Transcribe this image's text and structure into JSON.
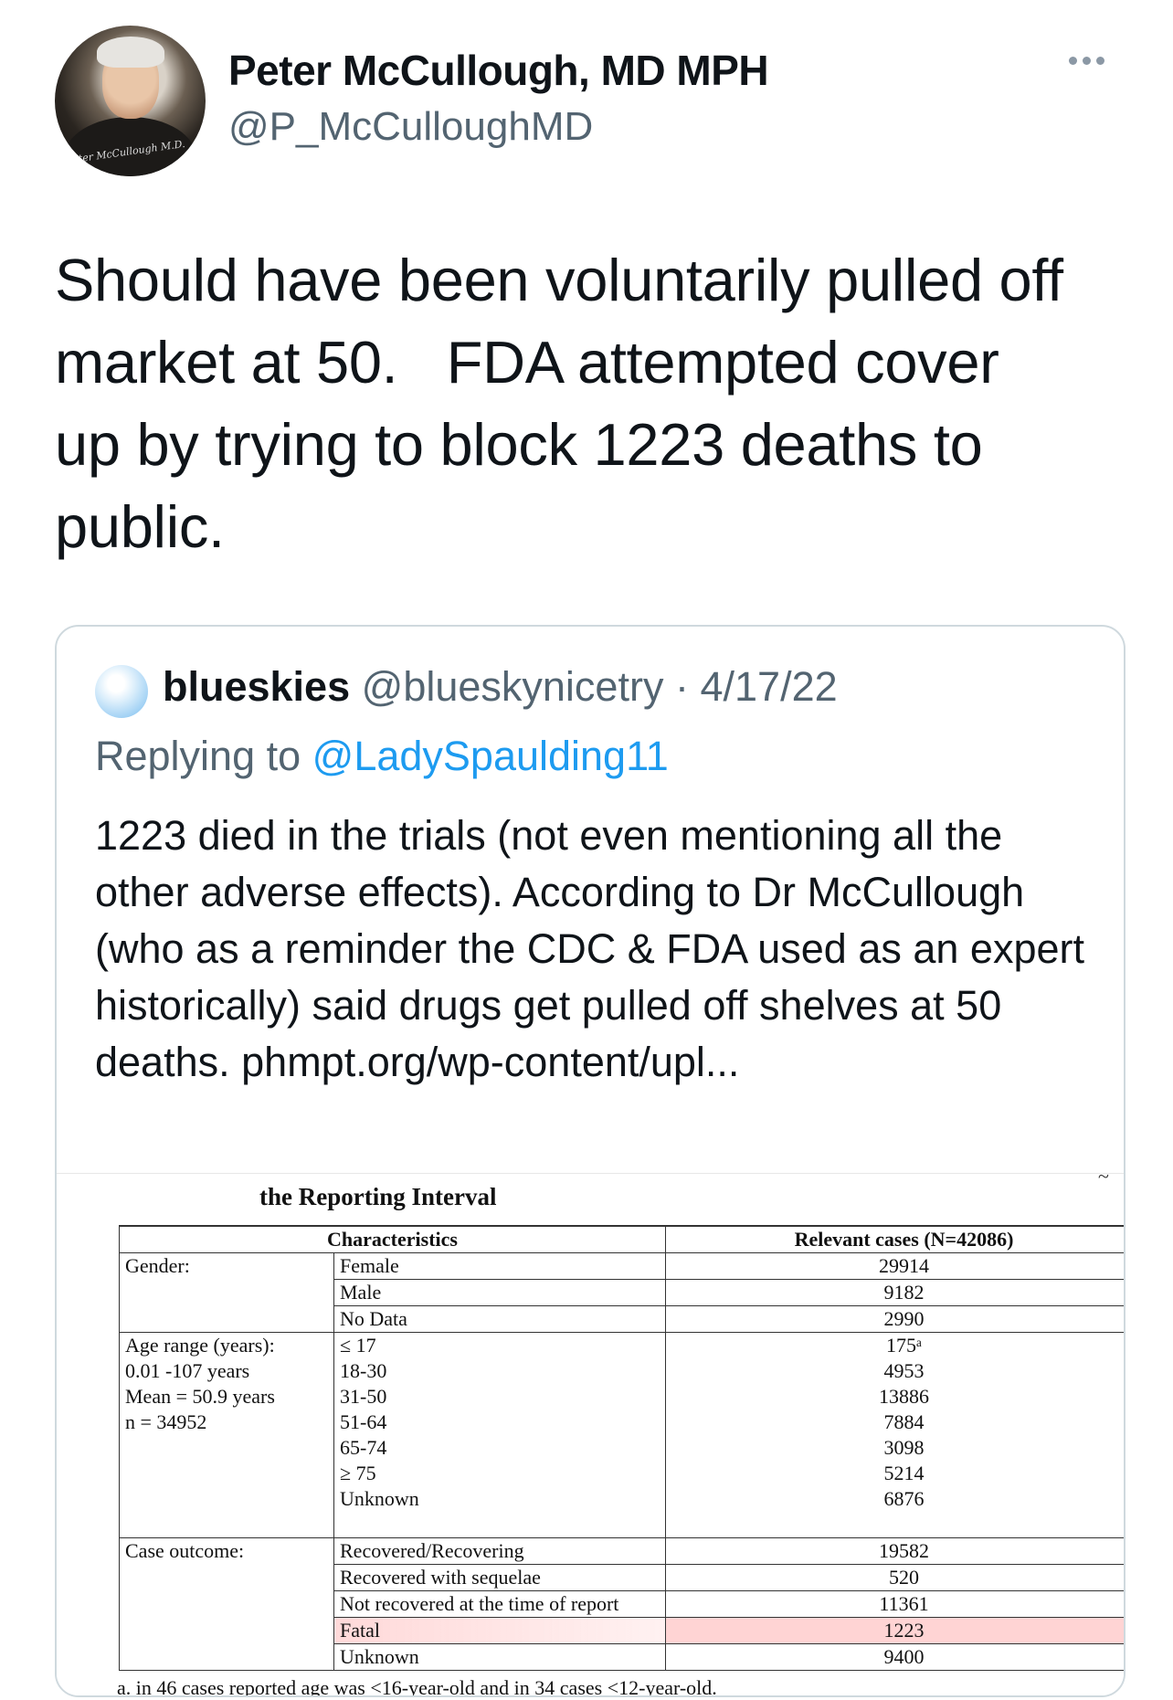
{
  "author": {
    "name": "Peter McCullough, MD MPH",
    "handle": "@P_McCulloughMD",
    "avatar_signature": "Peter McCullough M.D."
  },
  "icons": {
    "more": "more-horizontal-icon"
  },
  "tweet": {
    "text": "Should have been voluntarily pulled off\nmarket at 50.   FDA attempted cover\nup by trying to block 1223 deaths to\npublic."
  },
  "quote": {
    "name": "blueskies",
    "handle": "@blueskynicetry",
    "separator": "·",
    "date": "4/17/22",
    "replying_label": "Replying to",
    "replying_to": "@LadySpaulding11",
    "text": "1223 died in the trials (not even mentioning all the other adverse effects). According to Dr McCullough (who as a reminder the CDC & FDA used as an expert historically) said drugs get pulled off shelves at 50 deaths.",
    "link": "phmpt.org/wp-content/upl..."
  },
  "image": {
    "title": "the Reporting Interval",
    "top_tick": "~",
    "table": {
      "headers": [
        "Characteristics",
        "Relevant cases (N=42086)"
      ],
      "gender": {
        "label": "Gender:",
        "rows": [
          {
            "c": "Female",
            "v": "29914"
          },
          {
            "c": "Male",
            "v": "9182"
          },
          {
            "c": "No Data",
            "v": "2990"
          }
        ]
      },
      "age": {
        "label_lines": [
          "Age range (years):",
          "0.01 -107 years",
          "Mean = 50.9 years",
          "n = 34952"
        ],
        "rows": [
          {
            "c": "≤ 17",
            "v": "175ᵃ"
          },
          {
            "c": "18-30",
            "v": "4953"
          },
          {
            "c": "31-50",
            "v": "13886"
          },
          {
            "c": "51-64",
            "v": "7884"
          },
          {
            "c": "65-74",
            "v": "3098"
          },
          {
            "c": "≥ 75",
            "v": "5214"
          },
          {
            "c": "Unknown",
            "v": "6876"
          }
        ]
      },
      "outcome": {
        "label": "Case outcome:",
        "rows": [
          {
            "c": "Recovered/Recovering",
            "v": "19582"
          },
          {
            "c": "Recovered with sequelae",
            "v": "520"
          },
          {
            "c": "Not recovered at the time of report",
            "v": "11361"
          },
          {
            "c": "Fatal",
            "v": "1223"
          },
          {
            "c": "Unknown",
            "v": "9400"
          }
        ]
      }
    },
    "footnote": "a.    in 46 cases reported age was <16-year-old and in 34 cases <12-year-old."
  }
}
